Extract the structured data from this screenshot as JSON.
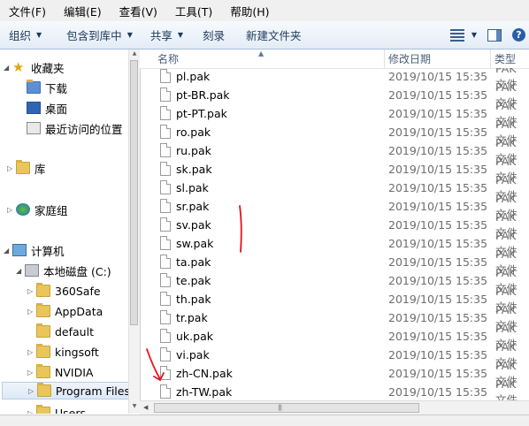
{
  "menu": [
    "文件(F)",
    "编辑(E)",
    "查看(V)",
    "工具(T)",
    "帮助(H)"
  ],
  "toolbar": {
    "organize": "组织",
    "include_in_library": "包含到库中",
    "share": "共享",
    "burn": "刻录",
    "new_folder": "新建文件夹"
  },
  "nav": {
    "favorites": "收藏夹",
    "downloads": "下载",
    "desktop": "桌面",
    "recent": "最近访问的位置",
    "libraries": "库",
    "homegroup": "家庭组",
    "computer": "计算机",
    "local_disk": "本地磁盘 (C:)",
    "folders": [
      "360Safe",
      "AppData",
      "default",
      "kingsoft",
      "NVIDIA",
      "Program Files",
      "Users"
    ]
  },
  "columns": {
    "name": "名称",
    "date": "修改日期",
    "type": "类型"
  },
  "files": [
    {
      "name": "pl.pak",
      "date": "2019/10/15 15:35",
      "type": "PAK 文件"
    },
    {
      "name": "pt-BR.pak",
      "date": "2019/10/15 15:35",
      "type": "PAK 文件"
    },
    {
      "name": "pt-PT.pak",
      "date": "2019/10/15 15:35",
      "type": "PAK 文件"
    },
    {
      "name": "ro.pak",
      "date": "2019/10/15 15:35",
      "type": "PAK 文件"
    },
    {
      "name": "ru.pak",
      "date": "2019/10/15 15:35",
      "type": "PAK 文件"
    },
    {
      "name": "sk.pak",
      "date": "2019/10/15 15:35",
      "type": "PAK 文件"
    },
    {
      "name": "sl.pak",
      "date": "2019/10/15 15:35",
      "type": "PAK 文件"
    },
    {
      "name": "sr.pak",
      "date": "2019/10/15 15:35",
      "type": "PAK 文件"
    },
    {
      "name": "sv.pak",
      "date": "2019/10/15 15:35",
      "type": "PAK 文件"
    },
    {
      "name": "sw.pak",
      "date": "2019/10/15 15:35",
      "type": "PAK 文件"
    },
    {
      "name": "ta.pak",
      "date": "2019/10/15 15:35",
      "type": "PAK 文件"
    },
    {
      "name": "te.pak",
      "date": "2019/10/15 15:35",
      "type": "PAK 文件"
    },
    {
      "name": "th.pak",
      "date": "2019/10/15 15:35",
      "type": "PAK 文件"
    },
    {
      "name": "tr.pak",
      "date": "2019/10/15 15:35",
      "type": "PAK 文件"
    },
    {
      "name": "uk.pak",
      "date": "2019/10/15 15:35",
      "type": "PAK 文件"
    },
    {
      "name": "vi.pak",
      "date": "2019/10/15 15:35",
      "type": "PAK 文件"
    },
    {
      "name": "zh-CN.pak",
      "date": "2019/10/15 15:35",
      "type": "PAK 文件"
    },
    {
      "name": "zh-TW.pak",
      "date": "2019/10/15 15:35",
      "type": "PAK 文件"
    }
  ],
  "annotation_color": "#e8101c"
}
